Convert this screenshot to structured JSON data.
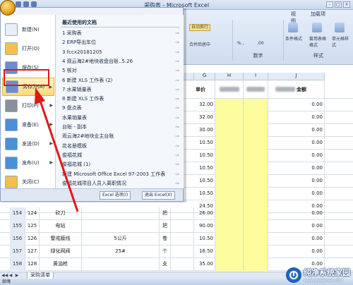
{
  "window": {
    "title": "采购表 - Microsoft Excel"
  },
  "ribbon": {
    "tab_view": "视图",
    "tab_addins": "加载项",
    "wrap_button": "自动换行",
    "merge_button": "合并后居中",
    "number_group": "数字",
    "conditional_format": "条件格式",
    "format_table": "套用表格格式",
    "cell_style": "单元格样式",
    "style_group": "样式",
    "percent": "% ,",
    "decimals": ".00"
  },
  "office_menu": {
    "left_items": [
      {
        "label": "新建(N)",
        "has_arrow": false
      },
      {
        "label": "打开(O)",
        "has_arrow": false
      },
      {
        "label": "保存(S)",
        "has_arrow": false
      },
      {
        "label": "另存为(A)",
        "has_arrow": true
      },
      {
        "label": "打印(P)",
        "has_arrow": true
      },
      {
        "label": "准备(E)",
        "has_arrow": true
      },
      {
        "label": "发送(D)",
        "has_arrow": true
      },
      {
        "label": "发布(U)",
        "has_arrow": true
      },
      {
        "label": "关闭(C)",
        "has_arrow": false
      }
    ],
    "recent_title": "最近使用的文档",
    "recent_docs": [
      "1 采购表",
      "2 ERP导出车位",
      "3 fccx20181205",
      "4 观云海2#地块收盘台账..5.26",
      "5 核对",
      "6 新建 XLS 工作表 (2)",
      "7 水果销量表",
      "8 新建 XLS 工作表",
      "9 盘点表",
      "水果销量表",
      "台账 - 副本",
      "观云海2#地块业主台账",
      "花名册模板",
      "俊福花城",
      "俊福花城 (1)",
      "新建 Microsoft Office Excel 97-2003 工作表",
      "俊福花城项目人员入离职情况"
    ],
    "options_button": "Excel 选项(I)",
    "exit_button": "退出 Excel(X)"
  },
  "columns": {
    "g": "G",
    "h": "H",
    "i": "I",
    "j": "J"
  },
  "header_row": {
    "unit_price": "单价",
    "amount": "金额"
  },
  "top_rows": [
    {
      "price": "32.00",
      "amount": "0.00"
    },
    {
      "price": "32.00",
      "amount": "0.00"
    },
    {
      "price": "30.00",
      "amount": "0.00"
    },
    {
      "price": "10.50",
      "amount": "0.00"
    },
    {
      "price": "10.50",
      "amount": "0.00"
    },
    {
      "price": "10.50",
      "amount": "0.00"
    },
    {
      "price": "10.50",
      "amount": "0.00"
    },
    {
      "price": "10.50",
      "amount": "0.00"
    },
    {
      "price": "24.50",
      "amount": "0.00"
    }
  ],
  "bottom_rows": [
    {
      "num": "154",
      "idx": "124",
      "name": "砍刀",
      "spec": "",
      "unit": "把",
      "price": "26.00",
      "amount": "0.00"
    },
    {
      "num": "155",
      "idx": "125",
      "name": "电钻",
      "spec": "",
      "unit": "把",
      "price": "90.00",
      "amount": "0.00"
    },
    {
      "num": "156",
      "idx": "126",
      "name": "警戒膜线",
      "spec": "5公斤",
      "unit": "卷",
      "price": "10.50",
      "amount": "0.00"
    },
    {
      "num": "157",
      "idx": "127",
      "name": "绿化网阀",
      "spec": "25#",
      "unit": "个",
      "price": "16.50",
      "amount": "0.00"
    },
    {
      "num": "158",
      "idx": "128",
      "name": "黄油枪",
      "spec": "",
      "unit": "支",
      "price": "35.00",
      "amount": "0.00"
    }
  ],
  "sheet_tab": "采购清单",
  "status": "就绪",
  "watermark": {
    "brand": "纯净系统家园",
    "url": "www.yidaimei.com"
  }
}
